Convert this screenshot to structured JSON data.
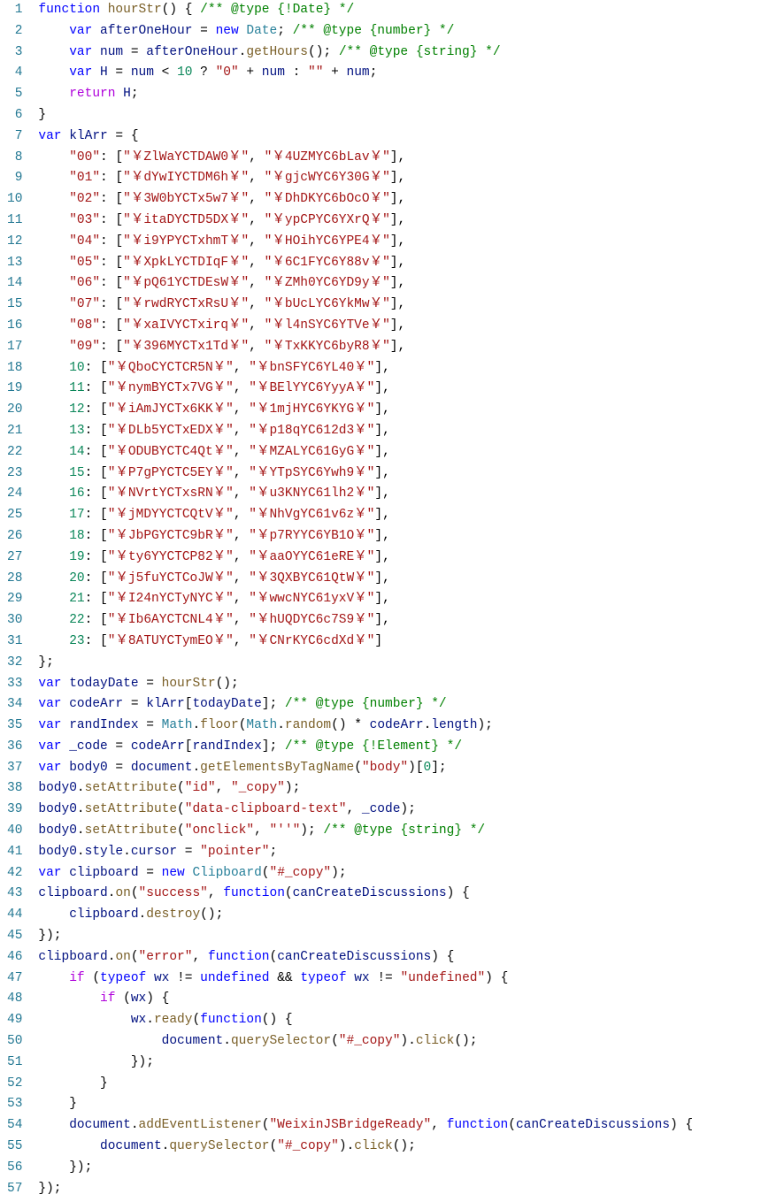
{
  "lineCount": 57,
  "lines": [
    [
      [
        "kw",
        "function"
      ],
      [
        "",
        " "
      ],
      [
        "fn",
        "hourStr"
      ],
      [
        "",
        "() { "
      ],
      [
        "com",
        "/** @type {!Date} */"
      ]
    ],
    [
      [
        "",
        "    "
      ],
      [
        "kw",
        "var"
      ],
      [
        "",
        " "
      ],
      [
        "var",
        "afterOneHour"
      ],
      [
        "",
        " = "
      ],
      [
        "kw",
        "new"
      ],
      [
        "",
        " "
      ],
      [
        "type",
        "Date"
      ],
      [
        "",
        "; "
      ],
      [
        "com",
        "/** @type {number} */"
      ]
    ],
    [
      [
        "",
        "    "
      ],
      [
        "kw",
        "var"
      ],
      [
        "",
        " "
      ],
      [
        "var",
        "num"
      ],
      [
        "",
        " = "
      ],
      [
        "var",
        "afterOneHour"
      ],
      [
        "",
        "."
      ],
      [
        "fn",
        "getHours"
      ],
      [
        "",
        "(); "
      ],
      [
        "com",
        "/** @type {string} */"
      ]
    ],
    [
      [
        "",
        "    "
      ],
      [
        "kw",
        "var"
      ],
      [
        "",
        " "
      ],
      [
        "var",
        "H"
      ],
      [
        "",
        " = "
      ],
      [
        "var",
        "num"
      ],
      [
        "",
        " < "
      ],
      [
        "num",
        "10"
      ],
      [
        "",
        " ? "
      ],
      [
        "str",
        "\"0\""
      ],
      [
        "",
        " + "
      ],
      [
        "var",
        "num"
      ],
      [
        "",
        " : "
      ],
      [
        "str",
        "\"\""
      ],
      [
        "",
        " + "
      ],
      [
        "var",
        "num"
      ],
      [
        "",
        ";"
      ]
    ],
    [
      [
        "",
        "    "
      ],
      [
        "ctl",
        "return"
      ],
      [
        "",
        " "
      ],
      [
        "var",
        "H"
      ],
      [
        "",
        ";"
      ]
    ],
    [
      [
        "",
        "}"
      ]
    ],
    [
      [
        "kw",
        "var"
      ],
      [
        "",
        " "
      ],
      [
        "var",
        "klArr"
      ],
      [
        "",
        " = {"
      ]
    ],
    [
      [
        "",
        "    "
      ],
      [
        "str",
        "\"00\""
      ],
      [
        "",
        ": ["
      ],
      [
        "str",
        "\"￥ZlWaYCTDAW0￥\""
      ],
      [
        "",
        ", "
      ],
      [
        "str",
        "\"￥4UZMYC6bLav￥\""
      ],
      [
        "",
        "],"
      ]
    ],
    [
      [
        "",
        "    "
      ],
      [
        "str",
        "\"01\""
      ],
      [
        "",
        ": ["
      ],
      [
        "str",
        "\"￥dYwIYCTDM6h￥\""
      ],
      [
        "",
        ", "
      ],
      [
        "str",
        "\"￥gjcWYC6Y30G￥\""
      ],
      [
        "",
        "],"
      ]
    ],
    [
      [
        "",
        "    "
      ],
      [
        "str",
        "\"02\""
      ],
      [
        "",
        ": ["
      ],
      [
        "str",
        "\"￥3W0bYCTx5w7￥\""
      ],
      [
        "",
        ", "
      ],
      [
        "str",
        "\"￥DhDKYC6bOcO￥\""
      ],
      [
        "",
        "],"
      ]
    ],
    [
      [
        "",
        "    "
      ],
      [
        "str",
        "\"03\""
      ],
      [
        "",
        ": ["
      ],
      [
        "str",
        "\"￥itaDYCTD5DX￥\""
      ],
      [
        "",
        ", "
      ],
      [
        "str",
        "\"￥ypCPYC6YXrQ￥\""
      ],
      [
        "",
        "],"
      ]
    ],
    [
      [
        "",
        "    "
      ],
      [
        "str",
        "\"04\""
      ],
      [
        "",
        ": ["
      ],
      [
        "str",
        "\"￥i9YPYCTxhmT￥\""
      ],
      [
        "",
        ", "
      ],
      [
        "str",
        "\"￥HOihYC6YPE4￥\""
      ],
      [
        "",
        "],"
      ]
    ],
    [
      [
        "",
        "    "
      ],
      [
        "str",
        "\"05\""
      ],
      [
        "",
        ": ["
      ],
      [
        "str",
        "\"￥XpkLYCTDIqF￥\""
      ],
      [
        "",
        ", "
      ],
      [
        "str",
        "\"￥6C1FYC6Y88v￥\""
      ],
      [
        "",
        "],"
      ]
    ],
    [
      [
        "",
        "    "
      ],
      [
        "str",
        "\"06\""
      ],
      [
        "",
        ": ["
      ],
      [
        "str",
        "\"￥pQ61YCTDEsW￥\""
      ],
      [
        "",
        ", "
      ],
      [
        "str",
        "\"￥ZMh0YC6YD9y￥\""
      ],
      [
        "",
        "],"
      ]
    ],
    [
      [
        "",
        "    "
      ],
      [
        "str",
        "\"07\""
      ],
      [
        "",
        ": ["
      ],
      [
        "str",
        "\"￥rwdRYCTxRsU￥\""
      ],
      [
        "",
        ", "
      ],
      [
        "str",
        "\"￥bUcLYC6YkMw￥\""
      ],
      [
        "",
        "],"
      ]
    ],
    [
      [
        "",
        "    "
      ],
      [
        "str",
        "\"08\""
      ],
      [
        "",
        ": ["
      ],
      [
        "str",
        "\"￥xaIVYCTxirq￥\""
      ],
      [
        "",
        ", "
      ],
      [
        "str",
        "\"￥l4nSYC6YTVe￥\""
      ],
      [
        "",
        "],"
      ]
    ],
    [
      [
        "",
        "    "
      ],
      [
        "str",
        "\"09\""
      ],
      [
        "",
        ": ["
      ],
      [
        "str",
        "\"￥396MYCTx1Td￥\""
      ],
      [
        "",
        ", "
      ],
      [
        "str",
        "\"￥TxKKYC6byR8￥\""
      ],
      [
        "",
        "],"
      ]
    ],
    [
      [
        "",
        "    "
      ],
      [
        "num",
        "10"
      ],
      [
        "",
        ": ["
      ],
      [
        "str",
        "\"￥QboCYCTCR5N￥\""
      ],
      [
        "",
        ", "
      ],
      [
        "str",
        "\"￥bnSFYC6YL40￥\""
      ],
      [
        "",
        "],"
      ]
    ],
    [
      [
        "",
        "    "
      ],
      [
        "num",
        "11"
      ],
      [
        "",
        ": ["
      ],
      [
        "str",
        "\"￥nymBYCTx7VG￥\""
      ],
      [
        "",
        ", "
      ],
      [
        "str",
        "\"￥BElYYC6YyyA￥\""
      ],
      [
        "",
        "],"
      ]
    ],
    [
      [
        "",
        "    "
      ],
      [
        "num",
        "12"
      ],
      [
        "",
        ": ["
      ],
      [
        "str",
        "\"￥iAmJYCTx6KK￥\""
      ],
      [
        "",
        ", "
      ],
      [
        "str",
        "\"￥1mjHYC6YKYG￥\""
      ],
      [
        "",
        "],"
      ]
    ],
    [
      [
        "",
        "    "
      ],
      [
        "num",
        "13"
      ],
      [
        "",
        ": ["
      ],
      [
        "str",
        "\"￥DLb5YCTxEDX￥\""
      ],
      [
        "",
        ", "
      ],
      [
        "str",
        "\"￥p18qYC612d3￥\""
      ],
      [
        "",
        "],"
      ]
    ],
    [
      [
        "",
        "    "
      ],
      [
        "num",
        "14"
      ],
      [
        "",
        ": ["
      ],
      [
        "str",
        "\"￥ODUBYCTC4Qt￥\""
      ],
      [
        "",
        ", "
      ],
      [
        "str",
        "\"￥MZALYC61GyG￥\""
      ],
      [
        "",
        "],"
      ]
    ],
    [
      [
        "",
        "    "
      ],
      [
        "num",
        "15"
      ],
      [
        "",
        ": ["
      ],
      [
        "str",
        "\"￥P7gPYCTC5EY￥\""
      ],
      [
        "",
        ", "
      ],
      [
        "str",
        "\"￥YTpSYC6Ywh9￥\""
      ],
      [
        "",
        "],"
      ]
    ],
    [
      [
        "",
        "    "
      ],
      [
        "num",
        "16"
      ],
      [
        "",
        ": ["
      ],
      [
        "str",
        "\"￥NVrtYCTxsRN￥\""
      ],
      [
        "",
        ", "
      ],
      [
        "str",
        "\"￥u3KNYC61lh2￥\""
      ],
      [
        "",
        "],"
      ]
    ],
    [
      [
        "",
        "    "
      ],
      [
        "num",
        "17"
      ],
      [
        "",
        ": ["
      ],
      [
        "str",
        "\"￥jMDYYCTCQtV￥\""
      ],
      [
        "",
        ", "
      ],
      [
        "str",
        "\"￥NhVgYC61v6z￥\""
      ],
      [
        "",
        "],"
      ]
    ],
    [
      [
        "",
        "    "
      ],
      [
        "num",
        "18"
      ],
      [
        "",
        ": ["
      ],
      [
        "str",
        "\"￥JbPGYCTC9bR￥\""
      ],
      [
        "",
        ", "
      ],
      [
        "str",
        "\"￥p7RYYC6YB1O￥\""
      ],
      [
        "",
        "],"
      ]
    ],
    [
      [
        "",
        "    "
      ],
      [
        "num",
        "19"
      ],
      [
        "",
        ": ["
      ],
      [
        "str",
        "\"￥ty6YYCTCP82￥\""
      ],
      [
        "",
        ", "
      ],
      [
        "str",
        "\"￥aaOYYC61eRE￥\""
      ],
      [
        "",
        "],"
      ]
    ],
    [
      [
        "",
        "    "
      ],
      [
        "num",
        "20"
      ],
      [
        "",
        ": ["
      ],
      [
        "str",
        "\"￥j5fuYCTCoJW￥\""
      ],
      [
        "",
        ", "
      ],
      [
        "str",
        "\"￥3QXBYC61QtW￥\""
      ],
      [
        "",
        "],"
      ]
    ],
    [
      [
        "",
        "    "
      ],
      [
        "num",
        "21"
      ],
      [
        "",
        ": ["
      ],
      [
        "str",
        "\"￥I24nYCTyNYC￥\""
      ],
      [
        "",
        ", "
      ],
      [
        "str",
        "\"￥wwcNYC61yxV￥\""
      ],
      [
        "",
        "],"
      ]
    ],
    [
      [
        "",
        "    "
      ],
      [
        "num",
        "22"
      ],
      [
        "",
        ": ["
      ],
      [
        "str",
        "\"￥Ib6AYCTCNL4￥\""
      ],
      [
        "",
        ", "
      ],
      [
        "str",
        "\"￥hUQDYC6c7S9￥\""
      ],
      [
        "",
        "],"
      ]
    ],
    [
      [
        "",
        "    "
      ],
      [
        "num",
        "23"
      ],
      [
        "",
        ": ["
      ],
      [
        "str",
        "\"￥8ATUYCTymEO￥\""
      ],
      [
        "",
        ", "
      ],
      [
        "str",
        "\"￥CNrKYC6cdXd￥\""
      ],
      [
        "",
        "]"
      ]
    ],
    [
      [
        "",
        "};"
      ]
    ],
    [
      [
        "kw",
        "var"
      ],
      [
        "",
        " "
      ],
      [
        "var",
        "todayDate"
      ],
      [
        "",
        " = "
      ],
      [
        "fn",
        "hourStr"
      ],
      [
        "",
        "();"
      ]
    ],
    [
      [
        "kw",
        "var"
      ],
      [
        "",
        " "
      ],
      [
        "var",
        "codeArr"
      ],
      [
        "",
        " = "
      ],
      [
        "var",
        "klArr"
      ],
      [
        "",
        "["
      ],
      [
        "var",
        "todayDate"
      ],
      [
        "",
        "]; "
      ],
      [
        "com",
        "/** @type {number} */"
      ]
    ],
    [
      [
        "kw",
        "var"
      ],
      [
        "",
        " "
      ],
      [
        "var",
        "randIndex"
      ],
      [
        "",
        " = "
      ],
      [
        "type",
        "Math"
      ],
      [
        "",
        "."
      ],
      [
        "fn",
        "floor"
      ],
      [
        "",
        "("
      ],
      [
        "type",
        "Math"
      ],
      [
        "",
        "."
      ],
      [
        "fn",
        "random"
      ],
      [
        "",
        "() * "
      ],
      [
        "var",
        "codeArr"
      ],
      [
        "",
        "."
      ],
      [
        "var",
        "length"
      ],
      [
        "",
        ");"
      ]
    ],
    [
      [
        "kw",
        "var"
      ],
      [
        "",
        " "
      ],
      [
        "var",
        "_code"
      ],
      [
        "",
        " = "
      ],
      [
        "var",
        "codeArr"
      ],
      [
        "",
        "["
      ],
      [
        "var",
        "randIndex"
      ],
      [
        "",
        "]; "
      ],
      [
        "com",
        "/** @type {!Element} */"
      ]
    ],
    [
      [
        "kw",
        "var"
      ],
      [
        "",
        " "
      ],
      [
        "var",
        "body0"
      ],
      [
        "",
        " = "
      ],
      [
        "var",
        "document"
      ],
      [
        "",
        "."
      ],
      [
        "fn",
        "getElementsByTagName"
      ],
      [
        "",
        "("
      ],
      [
        "str",
        "\"body\""
      ],
      [
        "",
        ")["
      ],
      [
        "num",
        "0"
      ],
      [
        "",
        "];"
      ]
    ],
    [
      [
        "var",
        "body0"
      ],
      [
        "",
        "."
      ],
      [
        "fn",
        "setAttribute"
      ],
      [
        "",
        "("
      ],
      [
        "str",
        "\"id\""
      ],
      [
        "",
        ", "
      ],
      [
        "str",
        "\"_copy\""
      ],
      [
        "",
        ");"
      ]
    ],
    [
      [
        "var",
        "body0"
      ],
      [
        "",
        "."
      ],
      [
        "fn",
        "setAttribute"
      ],
      [
        "",
        "("
      ],
      [
        "str",
        "\"data-clipboard-text\""
      ],
      [
        "",
        ", "
      ],
      [
        "var",
        "_code"
      ],
      [
        "",
        ");"
      ]
    ],
    [
      [
        "var",
        "body0"
      ],
      [
        "",
        "."
      ],
      [
        "fn",
        "setAttribute"
      ],
      [
        "",
        "("
      ],
      [
        "str",
        "\"onclick\""
      ],
      [
        "",
        ", "
      ],
      [
        "str",
        "\"''\""
      ],
      [
        "",
        "); "
      ],
      [
        "com",
        "/** @type {string} */"
      ]
    ],
    [
      [
        "var",
        "body0"
      ],
      [
        "",
        "."
      ],
      [
        "var",
        "style"
      ],
      [
        "",
        "."
      ],
      [
        "var",
        "cursor"
      ],
      [
        "",
        " = "
      ],
      [
        "str",
        "\"pointer\""
      ],
      [
        "",
        ";"
      ]
    ],
    [
      [
        "kw",
        "var"
      ],
      [
        "",
        " "
      ],
      [
        "var",
        "clipboard"
      ],
      [
        "",
        " = "
      ],
      [
        "kw",
        "new"
      ],
      [
        "",
        " "
      ],
      [
        "type",
        "Clipboard"
      ],
      [
        "",
        "("
      ],
      [
        "str",
        "\"#_copy\""
      ],
      [
        "",
        ");"
      ]
    ],
    [
      [
        "var",
        "clipboard"
      ],
      [
        "",
        "."
      ],
      [
        "fn",
        "on"
      ],
      [
        "",
        "("
      ],
      [
        "str",
        "\"success\""
      ],
      [
        "",
        ", "
      ],
      [
        "kw",
        "function"
      ],
      [
        "",
        "("
      ],
      [
        "var",
        "canCreateDiscussions"
      ],
      [
        "",
        ") {"
      ]
    ],
    [
      [
        "",
        "    "
      ],
      [
        "var",
        "clipboard"
      ],
      [
        "",
        "."
      ],
      [
        "fn",
        "destroy"
      ],
      [
        "",
        "();"
      ]
    ],
    [
      [
        "",
        "});"
      ]
    ],
    [
      [
        "var",
        "clipboard"
      ],
      [
        "",
        "."
      ],
      [
        "fn",
        "on"
      ],
      [
        "",
        "("
      ],
      [
        "str",
        "\"error\""
      ],
      [
        "",
        ", "
      ],
      [
        "kw",
        "function"
      ],
      [
        "",
        "("
      ],
      [
        "var",
        "canCreateDiscussions"
      ],
      [
        "",
        ") {"
      ]
    ],
    [
      [
        "",
        "    "
      ],
      [
        "ctl",
        "if"
      ],
      [
        "",
        " ("
      ],
      [
        "kw",
        "typeof"
      ],
      [
        "",
        " "
      ],
      [
        "var",
        "wx"
      ],
      [
        "",
        " != "
      ],
      [
        "kw",
        "undefined"
      ],
      [
        "",
        " && "
      ],
      [
        "kw",
        "typeof"
      ],
      [
        "",
        " "
      ],
      [
        "var",
        "wx"
      ],
      [
        "",
        " != "
      ],
      [
        "str",
        "\"undefined\""
      ],
      [
        "",
        ") {"
      ]
    ],
    [
      [
        "",
        "        "
      ],
      [
        "ctl",
        "if"
      ],
      [
        "",
        " ("
      ],
      [
        "var",
        "wx"
      ],
      [
        "",
        ") {"
      ]
    ],
    [
      [
        "",
        "            "
      ],
      [
        "var",
        "wx"
      ],
      [
        "",
        "."
      ],
      [
        "fn",
        "ready"
      ],
      [
        "",
        "("
      ],
      [
        "kw",
        "function"
      ],
      [
        "",
        "() {"
      ]
    ],
    [
      [
        "",
        "                "
      ],
      [
        "var",
        "document"
      ],
      [
        "",
        "."
      ],
      [
        "fn",
        "querySelector"
      ],
      [
        "",
        "("
      ],
      [
        "str",
        "\"#_copy\""
      ],
      [
        "",
        ")."
      ],
      [
        "fn",
        "click"
      ],
      [
        "",
        "();"
      ]
    ],
    [
      [
        "",
        "            });"
      ]
    ],
    [
      [
        "",
        "        }"
      ]
    ],
    [
      [
        "",
        "    }"
      ]
    ],
    [
      [
        "",
        "    "
      ],
      [
        "var",
        "document"
      ],
      [
        "",
        "."
      ],
      [
        "fn",
        "addEventListener"
      ],
      [
        "",
        "("
      ],
      [
        "str",
        "\"WeixinJSBridgeReady\""
      ],
      [
        "",
        ", "
      ],
      [
        "kw",
        "function"
      ],
      [
        "",
        "("
      ],
      [
        "var",
        "canCreateDiscussions"
      ],
      [
        "",
        ") {"
      ]
    ],
    [
      [
        "",
        "        "
      ],
      [
        "var",
        "document"
      ],
      [
        "",
        "."
      ],
      [
        "fn",
        "querySelector"
      ],
      [
        "",
        "("
      ],
      [
        "str",
        "\"#_copy\""
      ],
      [
        "",
        ")."
      ],
      [
        "fn",
        "click"
      ],
      [
        "",
        "();"
      ]
    ],
    [
      [
        "",
        "    });"
      ]
    ],
    [
      [
        "",
        "});"
      ]
    ]
  ]
}
